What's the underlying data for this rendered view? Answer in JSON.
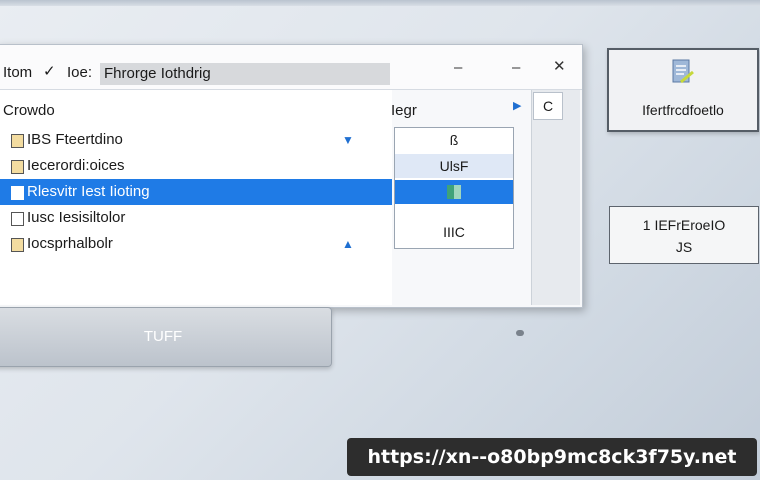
{
  "dialog": {
    "header": {
      "label_from": "Itom",
      "check_glyph": "✓",
      "label_loc": "Ioe:",
      "path_value": "Fhrorge Iothdrig",
      "btn_min": "–",
      "btn_restore": "–",
      "btn_close": "✕"
    },
    "left_header": "Crowdo",
    "right_header": "Iegr",
    "rows": [
      {
        "label": "IBS Fteertdino",
        "arrow": "▼"
      },
      {
        "label": "Iecerordi:oices",
        "arrow": ""
      },
      {
        "label": "Rlesvitr Iest Iioting",
        "arrow": ""
      },
      {
        "label": "Iusc Iesisiltolor",
        "arrow": ""
      },
      {
        "label": "Iocsprhalbolr",
        "arrow": "▲"
      }
    ],
    "right_list": [
      "ß",
      "UlsF",
      "",
      "IIIC"
    ],
    "side_button": "C",
    "side_arrow": "▶"
  },
  "under_button": {
    "label": "TUFF"
  },
  "panel_right": {
    "label": "Ifertfrcdfoetlo"
  },
  "panel_box": {
    "line1": "1 IEFrEroeIO",
    "line2": "JS"
  },
  "badge": {
    "text": "https://xn--o80bp9mc8ck3f75y.net"
  },
  "colors": {
    "selection": "#1f7be6",
    "accent_arrow": "#1f6fd1"
  }
}
